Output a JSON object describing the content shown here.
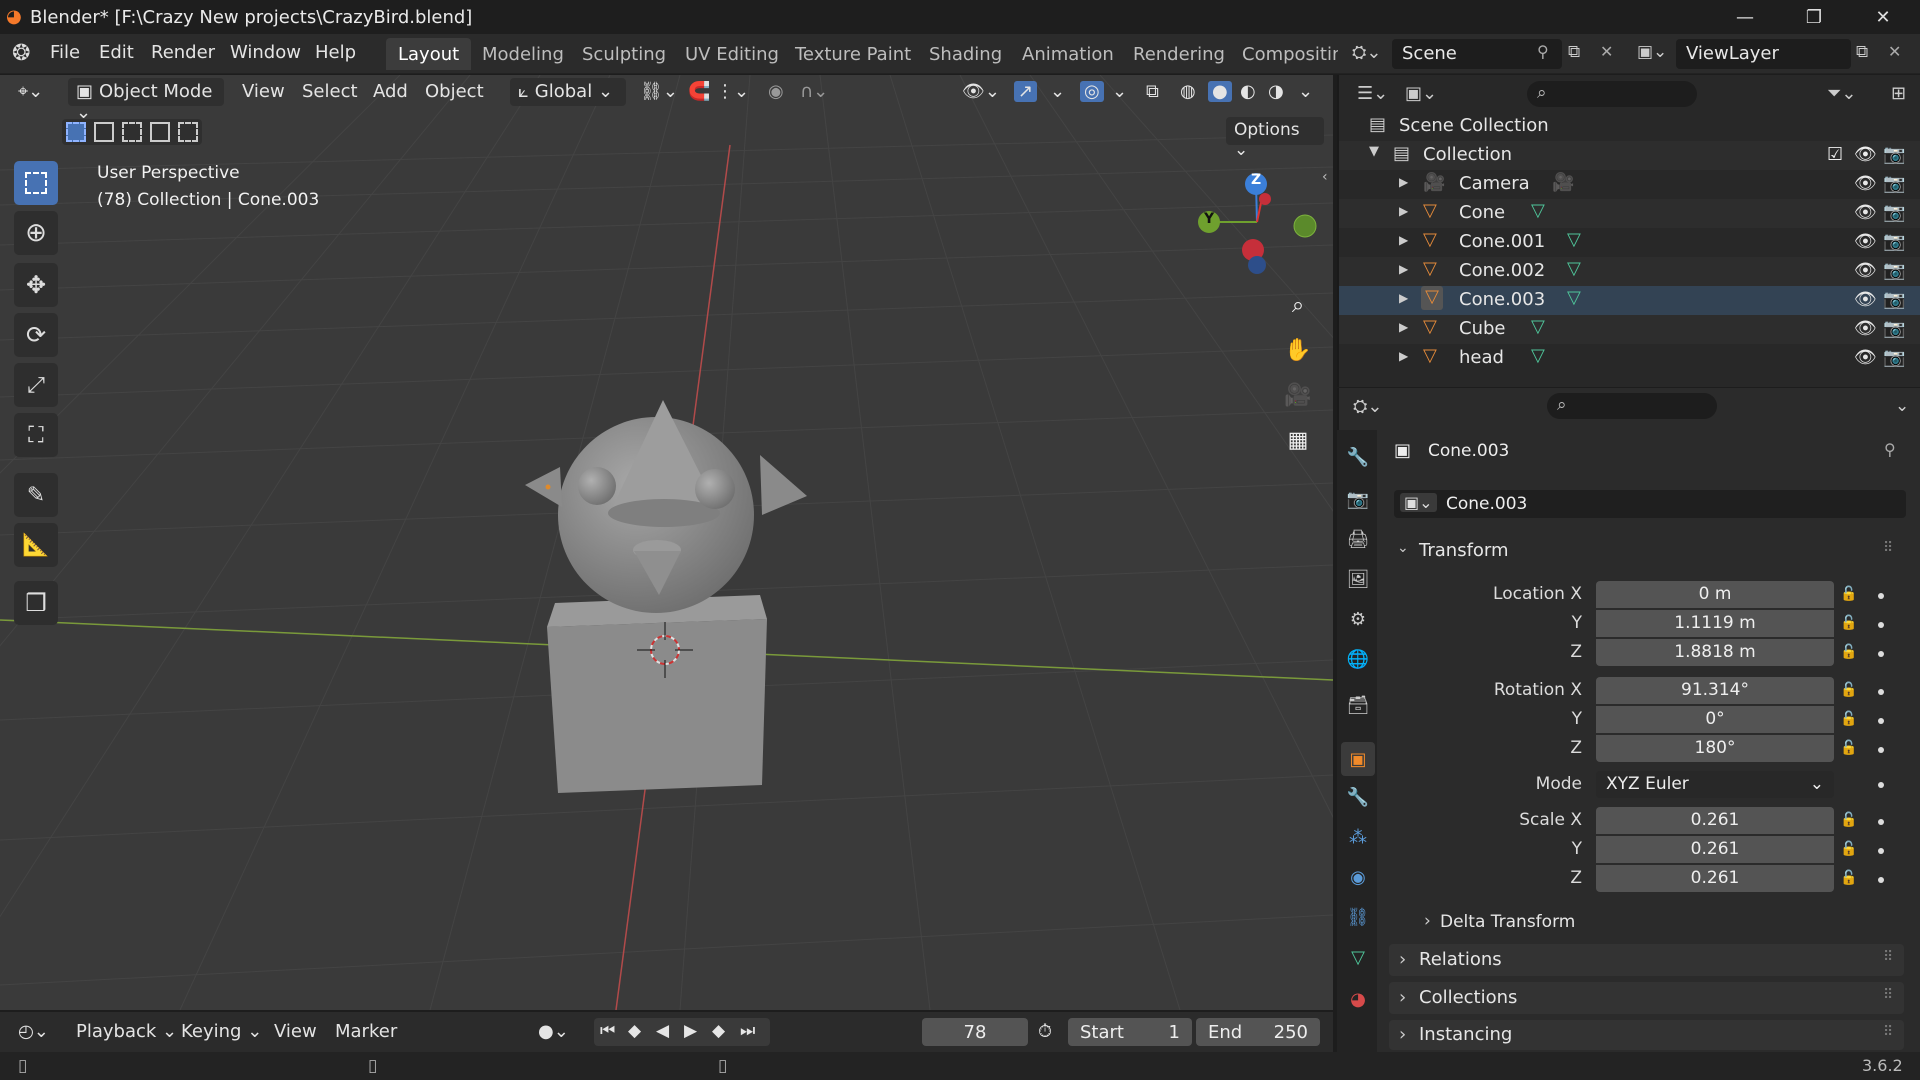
{
  "window": {
    "title": "Blender* [F:\\Crazy New projects\\CrazyBird.blend]"
  },
  "menu": {
    "items": [
      "File",
      "Edit",
      "Render",
      "Window",
      "Help"
    ]
  },
  "workspaces": [
    "Layout",
    "Modeling",
    "Sculpting",
    "UV Editing",
    "Texture Paint",
    "Shading",
    "Animation",
    "Rendering",
    "Compositin"
  ],
  "scene": {
    "name": "Scene",
    "view_layer": "ViewLayer"
  },
  "viewport_header": {
    "mode": "Object Mode",
    "menus": [
      "View",
      "Select",
      "Add",
      "Object"
    ],
    "orientation": "Global",
    "options": "Options"
  },
  "viewport": {
    "perspective": "User Perspective",
    "context": "(78) Collection | Cone.003"
  },
  "gizmo": {
    "z": "Z",
    "y": "Y"
  },
  "outliner": {
    "root": "Scene Collection",
    "collection": "Collection",
    "objects": [
      "Camera",
      "Cone",
      "Cone.001",
      "Cone.002",
      "Cone.003",
      "Cube",
      "head"
    ]
  },
  "properties": {
    "object_name": "Cone.003",
    "object_field": "Cone.003",
    "transform_label": "Transform",
    "location": {
      "label": "Location X",
      "x": "0 m",
      "y": "1.1119 m",
      "z": "1.8818 m"
    },
    "rotation": {
      "label": "Rotation X",
      "x": "91.314°",
      "y": "0°",
      "z": "180°"
    },
    "mode": {
      "label": "Mode",
      "value": "XYZ Euler"
    },
    "scale": {
      "label": "Scale X",
      "x": "0.261",
      "y": "0.261",
      "z": "0.261"
    },
    "axis_y": "Y",
    "axis_z": "Z",
    "panels": [
      "Delta Transform",
      "Relations",
      "Collections",
      "Instancing"
    ]
  },
  "timeline": {
    "menus": [
      "Playback",
      "Keying",
      "View",
      "Marker"
    ],
    "current_frame": "78",
    "start_label": "Start",
    "start": "1",
    "end_label": "End",
    "end": "250"
  },
  "status": {
    "version": "3.6.2"
  }
}
